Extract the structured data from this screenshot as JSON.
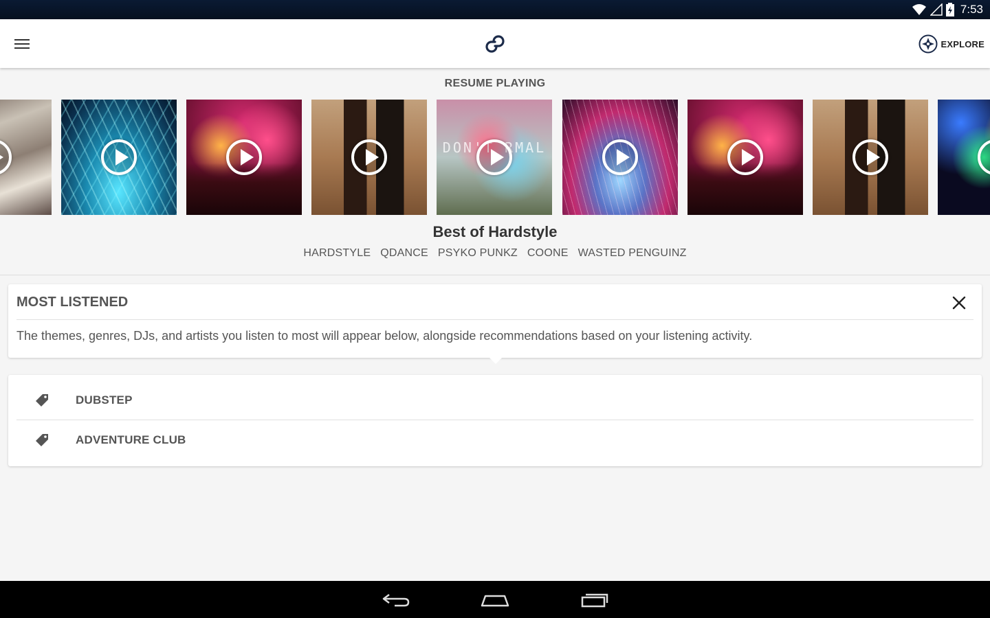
{
  "status_bar": {
    "time": "7:53",
    "icons": [
      "wifi-icon",
      "signal-icon",
      "battery-icon"
    ]
  },
  "app_bar": {
    "menu_icon": "hamburger-icon",
    "logo_icon": "link-logo-icon",
    "explore_label": "EXPLORE",
    "explore_icon": "compass-icon"
  },
  "resume": {
    "heading": "RESUME PLAYING",
    "tiles": [
      {
        "art": "room"
      },
      {
        "art": "laser"
      },
      {
        "art": "crowd"
      },
      {
        "art": "whiskey"
      },
      {
        "art": "smoke",
        "overlay_text": "DON'T  RMAL"
      },
      {
        "art": "fireworks"
      },
      {
        "art": "crowd"
      },
      {
        "art": "whiskey"
      },
      {
        "art": "neon"
      }
    ],
    "now_title": "Best of Hardstyle",
    "tags": [
      "HARDSTYLE",
      "QDANCE",
      "PSYKO PUNKZ",
      "COONE",
      "WASTED PENGUINZ"
    ]
  },
  "most_listened": {
    "title": "MOST LISTENED",
    "close_icon": "close-icon",
    "description": "The themes, genres, DJs, and artists you listen to most will appear below, alongside recommendations based on your listening activity."
  },
  "list": {
    "items": [
      {
        "label": "DUBSTEP",
        "icon": "tag-icon"
      },
      {
        "label": "ADVENTURE CLUB",
        "icon": "tag-icon"
      }
    ]
  },
  "nav_bar": {
    "buttons": [
      "back-icon",
      "home-icon",
      "recents-icon"
    ]
  },
  "colors": {
    "background": "#f5f5f5",
    "card": "#ffffff",
    "text_primary": "#333333",
    "text_secondary": "#555555",
    "status_bar": "#0a1a33"
  }
}
